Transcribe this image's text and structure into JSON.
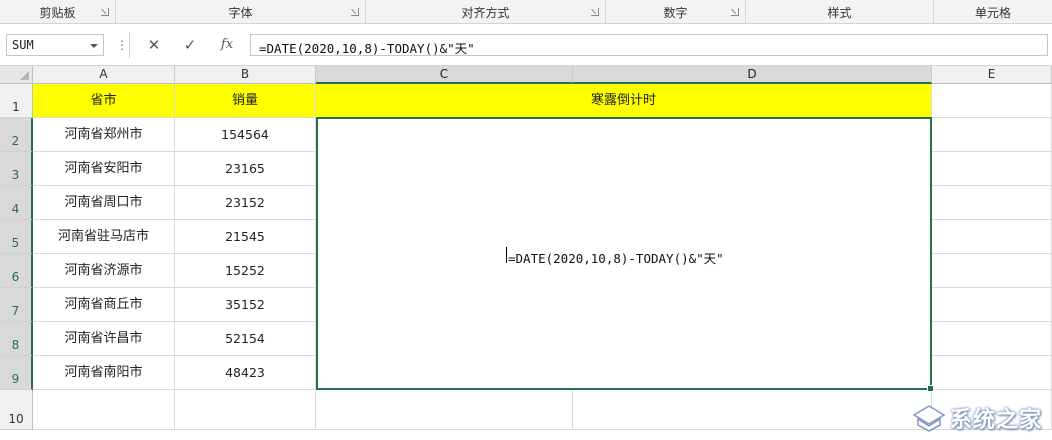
{
  "ribbon": {
    "groups": [
      {
        "label": "剪贴板",
        "launcher": true
      },
      {
        "label": "字体",
        "launcher": true
      },
      {
        "label": "对齐方式",
        "launcher": true
      },
      {
        "label": "数字",
        "launcher": true
      },
      {
        "label": "样式",
        "launcher": false
      },
      {
        "label": "单元格",
        "launcher": false
      }
    ]
  },
  "formula_bar": {
    "name_box": "SUM",
    "dots": "⋮",
    "cancel_icon": "✕",
    "enter_icon": "✓",
    "fx_label": "fx",
    "formula": "=DATE(2020,10,8)-TODAY()&\"天\""
  },
  "columns": [
    "A",
    "B",
    "C",
    "D",
    "E"
  ],
  "rows": [
    "1",
    "2",
    "3",
    "4",
    "5",
    "6",
    "7",
    "8",
    "9",
    "10"
  ],
  "sheet": {
    "header": {
      "a": "省市",
      "b": "销量",
      "cd": "寒露倒计时"
    },
    "data": [
      {
        "city": "河南省郑州市",
        "sales": "154564"
      },
      {
        "city": "河南省安阳市",
        "sales": "23165"
      },
      {
        "city": "河南省周口市",
        "sales": "23152"
      },
      {
        "city": "河南省驻马店市",
        "sales": "21545"
      },
      {
        "city": "河南省济源市",
        "sales": "15252"
      },
      {
        "city": "河南省商丘市",
        "sales": "35152"
      },
      {
        "city": "河南省许昌市",
        "sales": "52154"
      },
      {
        "city": "河南省南阳市",
        "sales": "48423"
      }
    ],
    "merged_cell_content": "=DATE(2020,10,8)-TODAY()&\"天\""
  },
  "colors": {
    "header_fill": "#ffff00",
    "selection": "#217346"
  },
  "watermark": {
    "text": "系统之家"
  }
}
